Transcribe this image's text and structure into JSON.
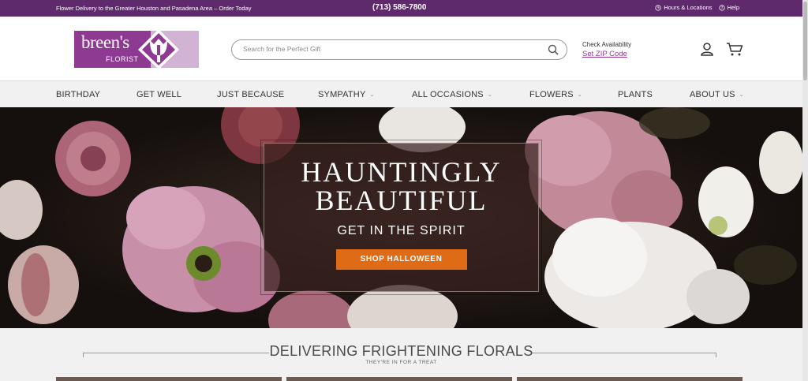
{
  "topbar": {
    "promo": "Flower Delivery to the Greater Houston and Pasadena Area – Order Today",
    "phone": "(713) 586-7800",
    "hours_label": "Hours & Locations",
    "help_label": "Help"
  },
  "logo": {
    "word": "breen's",
    "sub": "FLORIST",
    "icon": "tulip-logo-icon"
  },
  "search": {
    "placeholder": "Search for the Perfect Gift",
    "icon": "search-icon"
  },
  "availability": {
    "label": "Check Availability",
    "link": "Set ZIP Code"
  },
  "nav": {
    "items": [
      {
        "label": "BIRTHDAY"
      },
      {
        "label": "GET WELL"
      },
      {
        "label": "JUST BECAUSE"
      },
      {
        "label": "SYMPATHY",
        "chevron": "⌄"
      },
      {
        "label": "ALL OCCASIONS",
        "chevron": "⌄"
      },
      {
        "label": "FLOWERS",
        "chevron": "⌄"
      },
      {
        "label": "PLANTS"
      },
      {
        "label": "ABOUT US",
        "chevron": "⌄"
      }
    ]
  },
  "hero": {
    "title_line1": "HAUNTINGLY",
    "title_line2": "BEAUTIFUL",
    "subtitle": "GET IN THE SPIRIT",
    "cta": "SHOP HALLOWEEN"
  },
  "section": {
    "heading": "DELIVERING FRIGHTENING FLORALS",
    "tagline": "THEY'RE IN FOR A TREAT"
  },
  "colors": {
    "brand_purple": "#5e2a6c",
    "logo_purple": "#8e3a93",
    "cta_orange": "#e06b16"
  }
}
